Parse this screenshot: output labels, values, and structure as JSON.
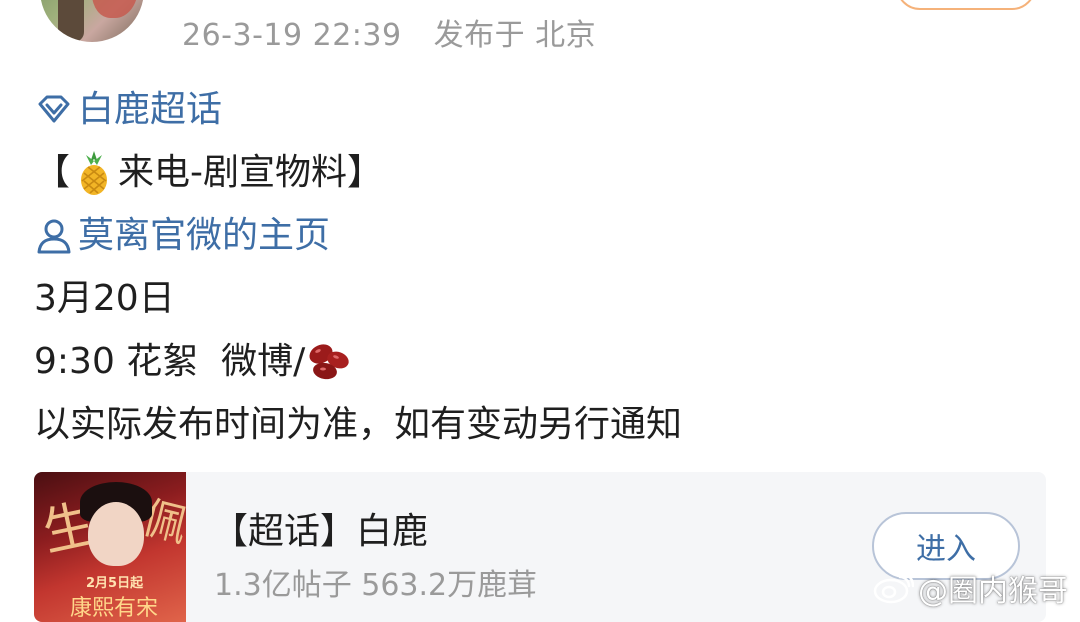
{
  "post": {
    "timestamp": "26-3-19 22:39",
    "location": "发布于 北京",
    "supertopic_link": "白鹿超话",
    "title_prefix": "【",
    "title_text": "来电-剧宣物料】",
    "profile_link": "莫离官微的主页",
    "date_line": "3月20日",
    "schedule_text": "9:30 花絮  微博/",
    "notice": "以实际发布时间为准，如有变动另行通知"
  },
  "card": {
    "title": "【超话】白鹿",
    "stats": "1.3亿帖子 563.2万鹿茸",
    "enter_label": "进入",
    "poster_date": "2月5日起"
  },
  "watermark": {
    "text": "@圈内猴哥"
  },
  "colors": {
    "link": "#3e6ea6",
    "meta_gray": "#9a9a9a",
    "card_bg": "#f5f6f8",
    "follow_border": "#f5b27a"
  },
  "icons": [
    "diamond-icon",
    "pineapple-emoji-icon",
    "person-icon",
    "beans-emoji-icon",
    "weibo-eye-icon"
  ]
}
